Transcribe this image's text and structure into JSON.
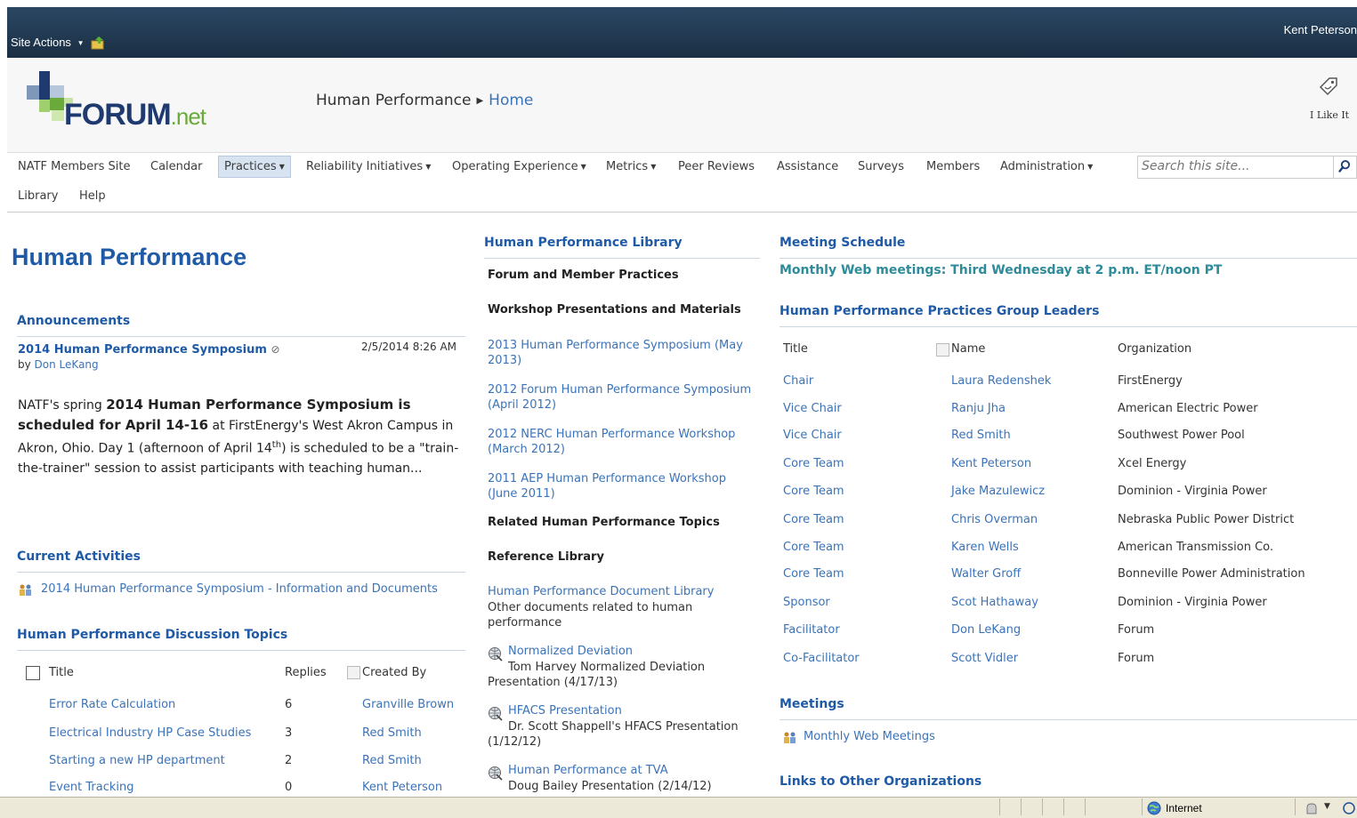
{
  "topbar": {
    "site_actions": "Site Actions",
    "user": "Kent Peterson"
  },
  "header": {
    "logo_main": "FORUM",
    "logo_suffix": ".net",
    "breadcrumb": [
      "Human Performance",
      "Home"
    ],
    "like_label": "I Like It"
  },
  "nav": {
    "items": [
      "NATF Members Site",
      "Calendar",
      "Practices",
      "Reliability Initiatives",
      "Operating Experience",
      "Metrics",
      "Peer Reviews",
      "Assistance",
      "Surveys",
      "Members",
      "Administration",
      "Library",
      "Help"
    ],
    "search_placeholder": "Search this site..."
  },
  "left": {
    "page_title": "Human Performance",
    "announcements": {
      "heading": "Announcements",
      "title": "2014 Human Performance Symposium",
      "date": "2/5/2014 8:26 AM",
      "by": "by",
      "author": "Don LeKang",
      "body1": "NATF's spring ",
      "body_bold": "2014 Human Performance Symposium is scheduled for April 14-16",
      "body2": " at FirstEnergy's West Akron Campus in Akron, Ohio.  Day 1 (afternoon of April 14",
      "body_sup": "th",
      "body3": ") is scheduled to be a \"train-the-trainer\" session to assist participants with teaching human..."
    },
    "current_activities": {
      "heading": "Current Activities",
      "item": "2014 Human Performance Symposium - Information and Documents"
    },
    "discussion": {
      "heading": "Human Performance Discussion Topics",
      "columns": [
        "Title",
        "Replies",
        "Created By"
      ],
      "rows": [
        {
          "title": "Error Rate Calculation",
          "replies": "6",
          "by": "Granville Brown"
        },
        {
          "title": "Electrical Industry HP Case Studies",
          "replies": "3",
          "by": "Red Smith"
        },
        {
          "title": "Starting a new HP department",
          "replies": "2",
          "by": "Red Smith"
        },
        {
          "title": "Event Tracking",
          "replies": "0",
          "by": "Kent Peterson"
        }
      ]
    }
  },
  "middle": {
    "heading": "Human Performance Library",
    "sec1": "Forum and Member Practices",
    "sec2": "Workshop Presentations and Materials",
    "workshops": [
      "2013 Human Performance Symposium (May 2013)",
      "2012 Forum Human Performance Symposium (April 2012)",
      "2012 NERC Human Performance Workshop (March 2012)",
      "2011 AEP Human Performance Workshop (June 2011)"
    ],
    "sec3": "Related Human Performance Topics",
    "sec4": "Reference Library",
    "doclib_link": "Human Performance Document Library",
    "doclib_desc": "Other documents related to human performance",
    "refs": [
      {
        "title": "Normalized Deviation",
        "desc": "Tom Harvey Normalized Deviation Presentation (4/17/13)"
      },
      {
        "title": "HFACS Presentation",
        "desc": "Dr. Scott Shappell's HFACS Presentation (1/12/12)"
      },
      {
        "title": "Human Performance at TVA",
        "desc": "Doug Bailey Presentation (2/14/12)"
      }
    ]
  },
  "right": {
    "meeting_heading": "Meeting Schedule",
    "meeting_text": "Monthly Web meetings: Third Wednesday at 2 p.m. ET/noon PT",
    "leaders_heading": "Human Performance Practices Group Leaders",
    "columns": [
      "Title",
      "Name",
      "Organization"
    ],
    "leaders": [
      {
        "title": "Chair",
        "name": "Laura Redenshek",
        "org": "FirstEnergy"
      },
      {
        "title": "Vice Chair",
        "name": "Ranju Jha",
        "org": "American Electric Power"
      },
      {
        "title": "Vice Chair",
        "name": "Red Smith",
        "org": "Southwest Power Pool"
      },
      {
        "title": "Core Team",
        "name": "Kent Peterson",
        "org": "Xcel Energy"
      },
      {
        "title": "Core Team",
        "name": "Jake Mazulewicz",
        "org": "Dominion - Virginia Power"
      },
      {
        "title": "Core Team",
        "name": "Chris Overman",
        "org": "Nebraska Public Power District"
      },
      {
        "title": "Core Team",
        "name": "Karen Wells",
        "org": "American Transmission Co."
      },
      {
        "title": "Core Team",
        "name": "Walter Groff",
        "org": "Bonneville Power Administration"
      },
      {
        "title": "Sponsor",
        "name": "Scot Hathaway",
        "org": "Dominion - Virginia Power"
      },
      {
        "title": "Facilitator",
        "name": "Don LeKang",
        "org": "Forum"
      },
      {
        "title": "Co-Facilitator",
        "name": "Scott Vidler",
        "org": "Forum"
      }
    ],
    "meetings_heading": "Meetings",
    "meetings_item": "Monthly Web Meetings",
    "links_heading": "Links to Other Organizations"
  },
  "statusbar": {
    "zone": "Internet"
  },
  "colors": {
    "topbar": "#21374c",
    "link": "#3b73b9",
    "heading": "#1f5aa6",
    "teal_heading": "#2e8b9a"
  }
}
